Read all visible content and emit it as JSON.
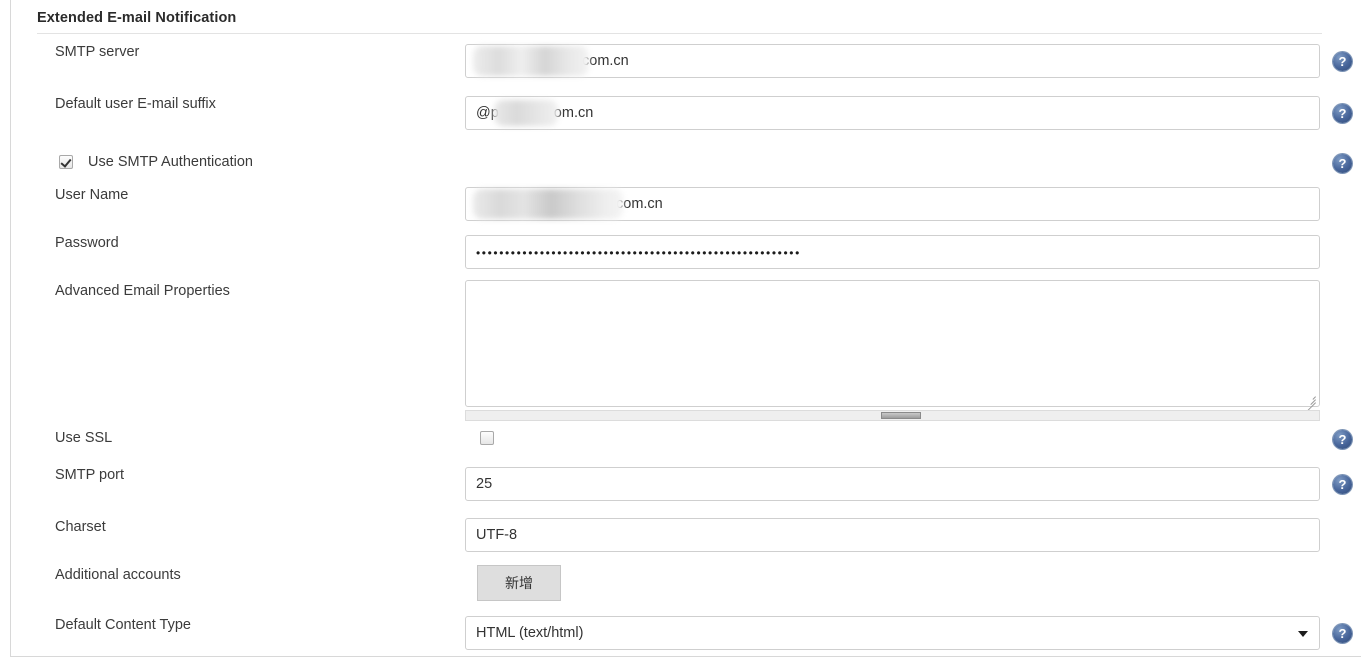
{
  "section": {
    "title": "Extended E-mail Notification"
  },
  "fields": {
    "smtp_server": {
      "label": "SMTP server",
      "value": "com.cn",
      "redacted": true
    },
    "email_suffix": {
      "label": "Default user E-mail suffix",
      "value_prefix": "@p",
      "value_suffix": "om.cn",
      "redacted": true
    },
    "use_smtp_auth": {
      "label": "Use SMTP Authentication",
      "checked": true
    },
    "user_name": {
      "label": "User Name",
      "value": "com.cn",
      "redacted": true
    },
    "password": {
      "label": "Password",
      "value": "••••••••••••••••••••••••••••••••••••••••••••••••••••••••"
    },
    "advanced_email_properties": {
      "label": "Advanced Email Properties",
      "value": ""
    },
    "use_ssl": {
      "label": "Use SSL",
      "checked": false
    },
    "smtp_port": {
      "label": "SMTP port",
      "value": "25"
    },
    "charset": {
      "label": "Charset",
      "value": "UTF-8"
    },
    "additional_accounts": {
      "label": "Additional accounts",
      "button_label": "新增"
    },
    "default_content_type": {
      "label": "Default Content Type",
      "value": "HTML (text/html)"
    }
  },
  "icons": {
    "help_glyph": "?",
    "help_name": "help-icon"
  },
  "colors": {
    "help_blue": "#47659a",
    "border": "#cfcfcf",
    "text": "#333333",
    "button_bg": "#dedede"
  }
}
